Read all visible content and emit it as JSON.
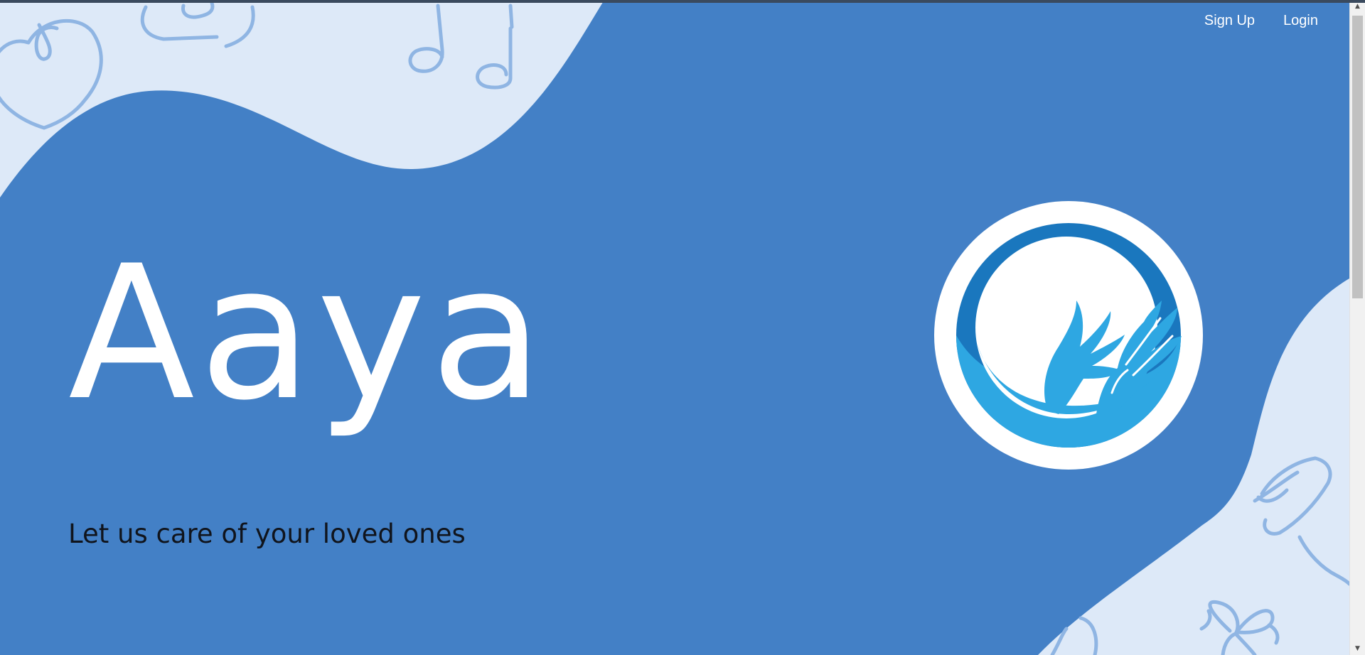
{
  "nav": {
    "signup_label": "Sign Up",
    "login_label": "Login"
  },
  "hero": {
    "title": "Aaya",
    "tagline": "Let us care of your loved ones"
  },
  "logo": {
    "icon": "caring-hands-circle-icon"
  },
  "colors": {
    "primary_blue": "#4380c6",
    "light_bg": "#dde9f8",
    "doodle": "#8fb5e3",
    "logo_ring_dark": "#1a77be",
    "logo_ring_light": "#2ea7e2"
  },
  "scrollbar": {
    "up_icon": "scroll-up-arrow-icon",
    "down_icon": "scroll-down-arrow-icon"
  }
}
